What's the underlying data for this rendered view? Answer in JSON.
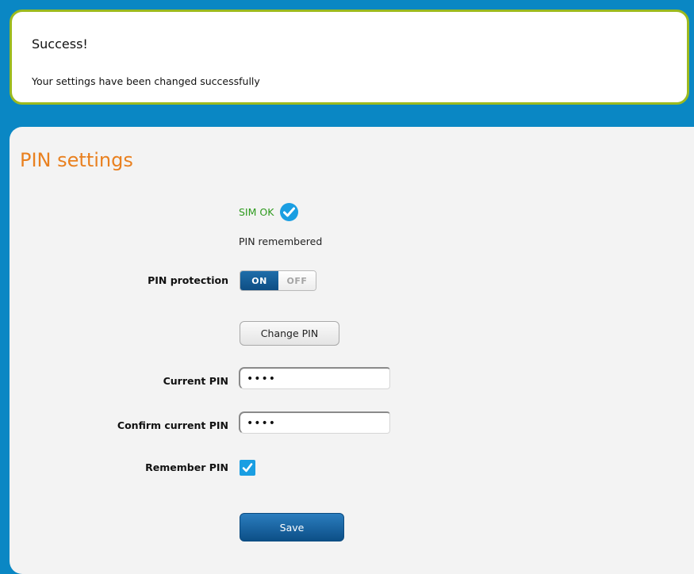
{
  "alert": {
    "title": "Success!",
    "message": "Your settings have been changed successfully"
  },
  "panel": {
    "title": "PIN settings"
  },
  "status": {
    "sim": "SIM OK",
    "pin_state": "PIN remembered"
  },
  "pin_protection": {
    "label": "PIN protection",
    "on_label": "ON",
    "off_label": "OFF",
    "selected": "ON"
  },
  "change_pin": {
    "label": "Change PIN"
  },
  "current_pin": {
    "label": "Current PIN",
    "value": "••••"
  },
  "confirm_pin": {
    "label": "Confirm current PIN",
    "value": "••••"
  },
  "remember_pin": {
    "label": "Remember PIN",
    "checked": true
  },
  "save": {
    "label": "Save"
  },
  "colors": {
    "background": "#0a87c4",
    "alert_border": "#9cba1f",
    "title_orange": "#e9801f",
    "sim_ok_green": "#2e9a1e",
    "accent_blue": "#1a9ee2",
    "button_dark_blue": "#0c4f87"
  },
  "icons": {
    "sim_status": "check-circle-icon",
    "remember_checkbox": "checkmark-icon"
  }
}
